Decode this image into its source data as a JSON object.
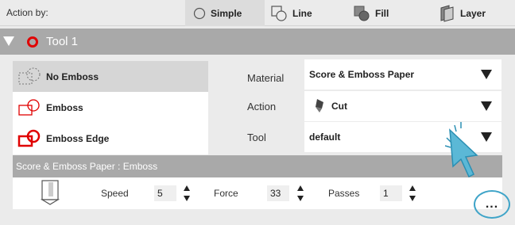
{
  "topbar": {
    "action_by": "Action by:",
    "modes": [
      {
        "label": "Simple",
        "icon": "circle-outline-icon",
        "active": true
      },
      {
        "label": "Line",
        "icon": "line-shapes-icon",
        "active": false
      },
      {
        "label": "Fill",
        "icon": "fill-shapes-icon",
        "active": false
      },
      {
        "label": "Layer",
        "icon": "layer-icon",
        "active": false
      }
    ]
  },
  "tool": {
    "title": "Tool 1",
    "ring_color": "#e00000"
  },
  "emboss_options": [
    {
      "label": "No Emboss",
      "icon": "no-emboss-icon",
      "selected": true
    },
    {
      "label": "Emboss",
      "icon": "emboss-icon",
      "selected": false
    },
    {
      "label": "Emboss Edge",
      "icon": "emboss-edge-icon",
      "selected": false
    }
  ],
  "fields": {
    "material_label": "Material",
    "material_value": "Score & Emboss Paper",
    "action_label": "Action",
    "action_value": "Cut",
    "tool_label": "Tool",
    "tool_value": "default"
  },
  "section_title": "Score & Emboss Paper : Emboss",
  "params": {
    "speed_label": "Speed",
    "speed_value": "5",
    "force_label": "Force",
    "force_value": "33",
    "passes_label": "Passes",
    "passes_value": "1"
  },
  "more_label": "...",
  "accent_color": "#3fa4c8"
}
